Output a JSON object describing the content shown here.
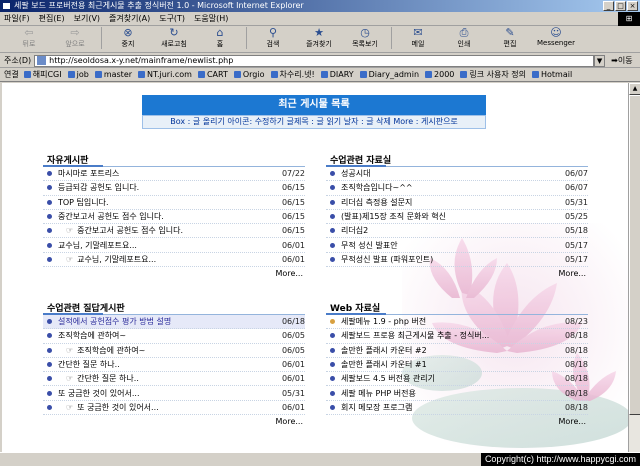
{
  "window": {
    "title": "세팔 보드 프로버전용 최근게시물 추출 정식버전 1.0 - Microsoft Internet Explorer",
    "controls": [
      "_",
      "□",
      "×"
    ]
  },
  "menu": [
    "파일(F)",
    "편집(E)",
    "보기(V)",
    "즐겨찾기(A)",
    "도구(T)",
    "도움말(H)"
  ],
  "toolbar": [
    {
      "label": "뒤로",
      "icon": "back-arrow-icon",
      "glyph": "⇦",
      "disabled": true
    },
    {
      "label": "앞으로",
      "icon": "forward-arrow-icon",
      "glyph": "⇨",
      "disabled": true
    },
    {
      "label": "중지",
      "icon": "stop-icon",
      "glyph": "⊗",
      "disabled": false
    },
    {
      "label": "새로고침",
      "icon": "refresh-icon",
      "glyph": "↻",
      "disabled": false
    },
    {
      "label": "홈",
      "icon": "home-icon",
      "glyph": "⌂",
      "disabled": false
    },
    {
      "label": "검색",
      "icon": "search-icon",
      "glyph": "⚲",
      "disabled": false
    },
    {
      "label": "즐겨찾기",
      "icon": "favorites-icon",
      "glyph": "★",
      "disabled": false
    },
    {
      "label": "목록보기",
      "icon": "history-icon",
      "glyph": "◷",
      "disabled": false
    },
    {
      "label": "메일",
      "icon": "mail-icon",
      "glyph": "✉",
      "disabled": false
    },
    {
      "label": "인쇄",
      "icon": "print-icon",
      "glyph": "⎙",
      "disabled": false
    },
    {
      "label": "편집",
      "icon": "edit-icon",
      "glyph": "✎",
      "disabled": false
    },
    {
      "label": "Messenger",
      "icon": "messenger-icon",
      "glyph": "☺",
      "disabled": false
    }
  ],
  "address": {
    "label": "주소(D)",
    "url": "http://seoldosa.x-y.net/mainframe/newlist.php",
    "go": "이동"
  },
  "links": {
    "label": "연결",
    "items": [
      "해피CGI",
      "job",
      "master",
      "NT.juri.com",
      "CART",
      "Orgio",
      "차수리.넷!",
      "DIARY",
      "Diary_admin",
      "2000",
      "링크 사용자 정의",
      "Hotmail"
    ]
  },
  "page": {
    "title": "최근 게시물 목록",
    "legend": "Box : 글 올리기    아이콘: 수정하기    글제목 : 글 읽기    날자 : 글 삭제    More : 게시판으로",
    "more": "More...",
    "reply_mark": "☞"
  },
  "panels": [
    {
      "title": "자유게시판",
      "items": [
        {
          "text": "마시마로 포트리스",
          "date": "07/22",
          "reply": false
        },
        {
          "text": "등급되감 공헌도 입니다.",
          "date": "06/15",
          "reply": false
        },
        {
          "text": "TOP 팁입니다.",
          "date": "06/15",
          "reply": false
        },
        {
          "text": "중간보고서 공헌도 점수 입니다.",
          "date": "06/15",
          "reply": false
        },
        {
          "text": "중간보고서 공헌도 점수 입니다.",
          "date": "06/15",
          "reply": true
        },
        {
          "text": "교수님, 기말레포트요...",
          "date": "06/01",
          "reply": false
        },
        {
          "text": "교수님, 기말레포트요...",
          "date": "06/01",
          "reply": true
        }
      ]
    },
    {
      "title": "수업관련 자료실",
      "items": [
        {
          "text": "성공시대",
          "date": "06/07",
          "reply": false
        },
        {
          "text": "조직학습입니다~^^",
          "date": "06/07",
          "reply": false
        },
        {
          "text": "리더십 측정용 설문지",
          "date": "05/31",
          "reply": false
        },
        {
          "text": "(발표)제15장 조직 문화와 혁신",
          "date": "05/25",
          "reply": false
        },
        {
          "text": "리더십2",
          "date": "05/18",
          "reply": false
        },
        {
          "text": "무적 성신 발표안",
          "date": "05/17",
          "reply": false
        },
        {
          "text": "무적성신 발표 (파워포인트)",
          "date": "05/17",
          "reply": false
        }
      ]
    },
    {
      "title": "수업관련 질답게시판",
      "items": [
        {
          "text": "설적에서 공헌점수 평가 방법 설명",
          "date": "06/18",
          "reply": false,
          "selected": true
        },
        {
          "text": "조직학습에 관하여~",
          "date": "06/05",
          "reply": false
        },
        {
          "text": "조직학습에 관하여~",
          "date": "06/05",
          "reply": true
        },
        {
          "text": "간단한 질문 하나..",
          "date": "06/01",
          "reply": false
        },
        {
          "text": "간단한 질문 하나..",
          "date": "06/01",
          "reply": true
        },
        {
          "text": "또 궁금한 것이 있어서...",
          "date": "05/31",
          "reply": false
        },
        {
          "text": "또 궁금한 것이 있어서...",
          "date": "06/01",
          "reply": true
        }
      ]
    },
    {
      "title": "Web 자료실",
      "items": [
        {
          "text": "세팔메뉴 1.9 - php 버전",
          "date": "08/23",
          "reply": false,
          "orange": true
        },
        {
          "text": "세팔보드 프로용 최근게시물 추출 - 정식버...",
          "date": "08/18",
          "reply": false
        },
        {
          "text": "솔만한 플래시 카운터 #2",
          "date": "08/18",
          "reply": false
        },
        {
          "text": "솔만한 플래시 카운터 #1",
          "date": "08/18",
          "reply": false
        },
        {
          "text": "세팔보드 4.5 버전용 관리기",
          "date": "08/18",
          "reply": false
        },
        {
          "text": "세팔 메뉴 PHP 버전용",
          "date": "08/18",
          "reply": false
        },
        {
          "text": "회지 메모장 프로그램",
          "date": "08/18",
          "reply": false
        }
      ]
    }
  ],
  "status": {
    "copyright": "Copyright(c) http://www.happycgi.com"
  }
}
